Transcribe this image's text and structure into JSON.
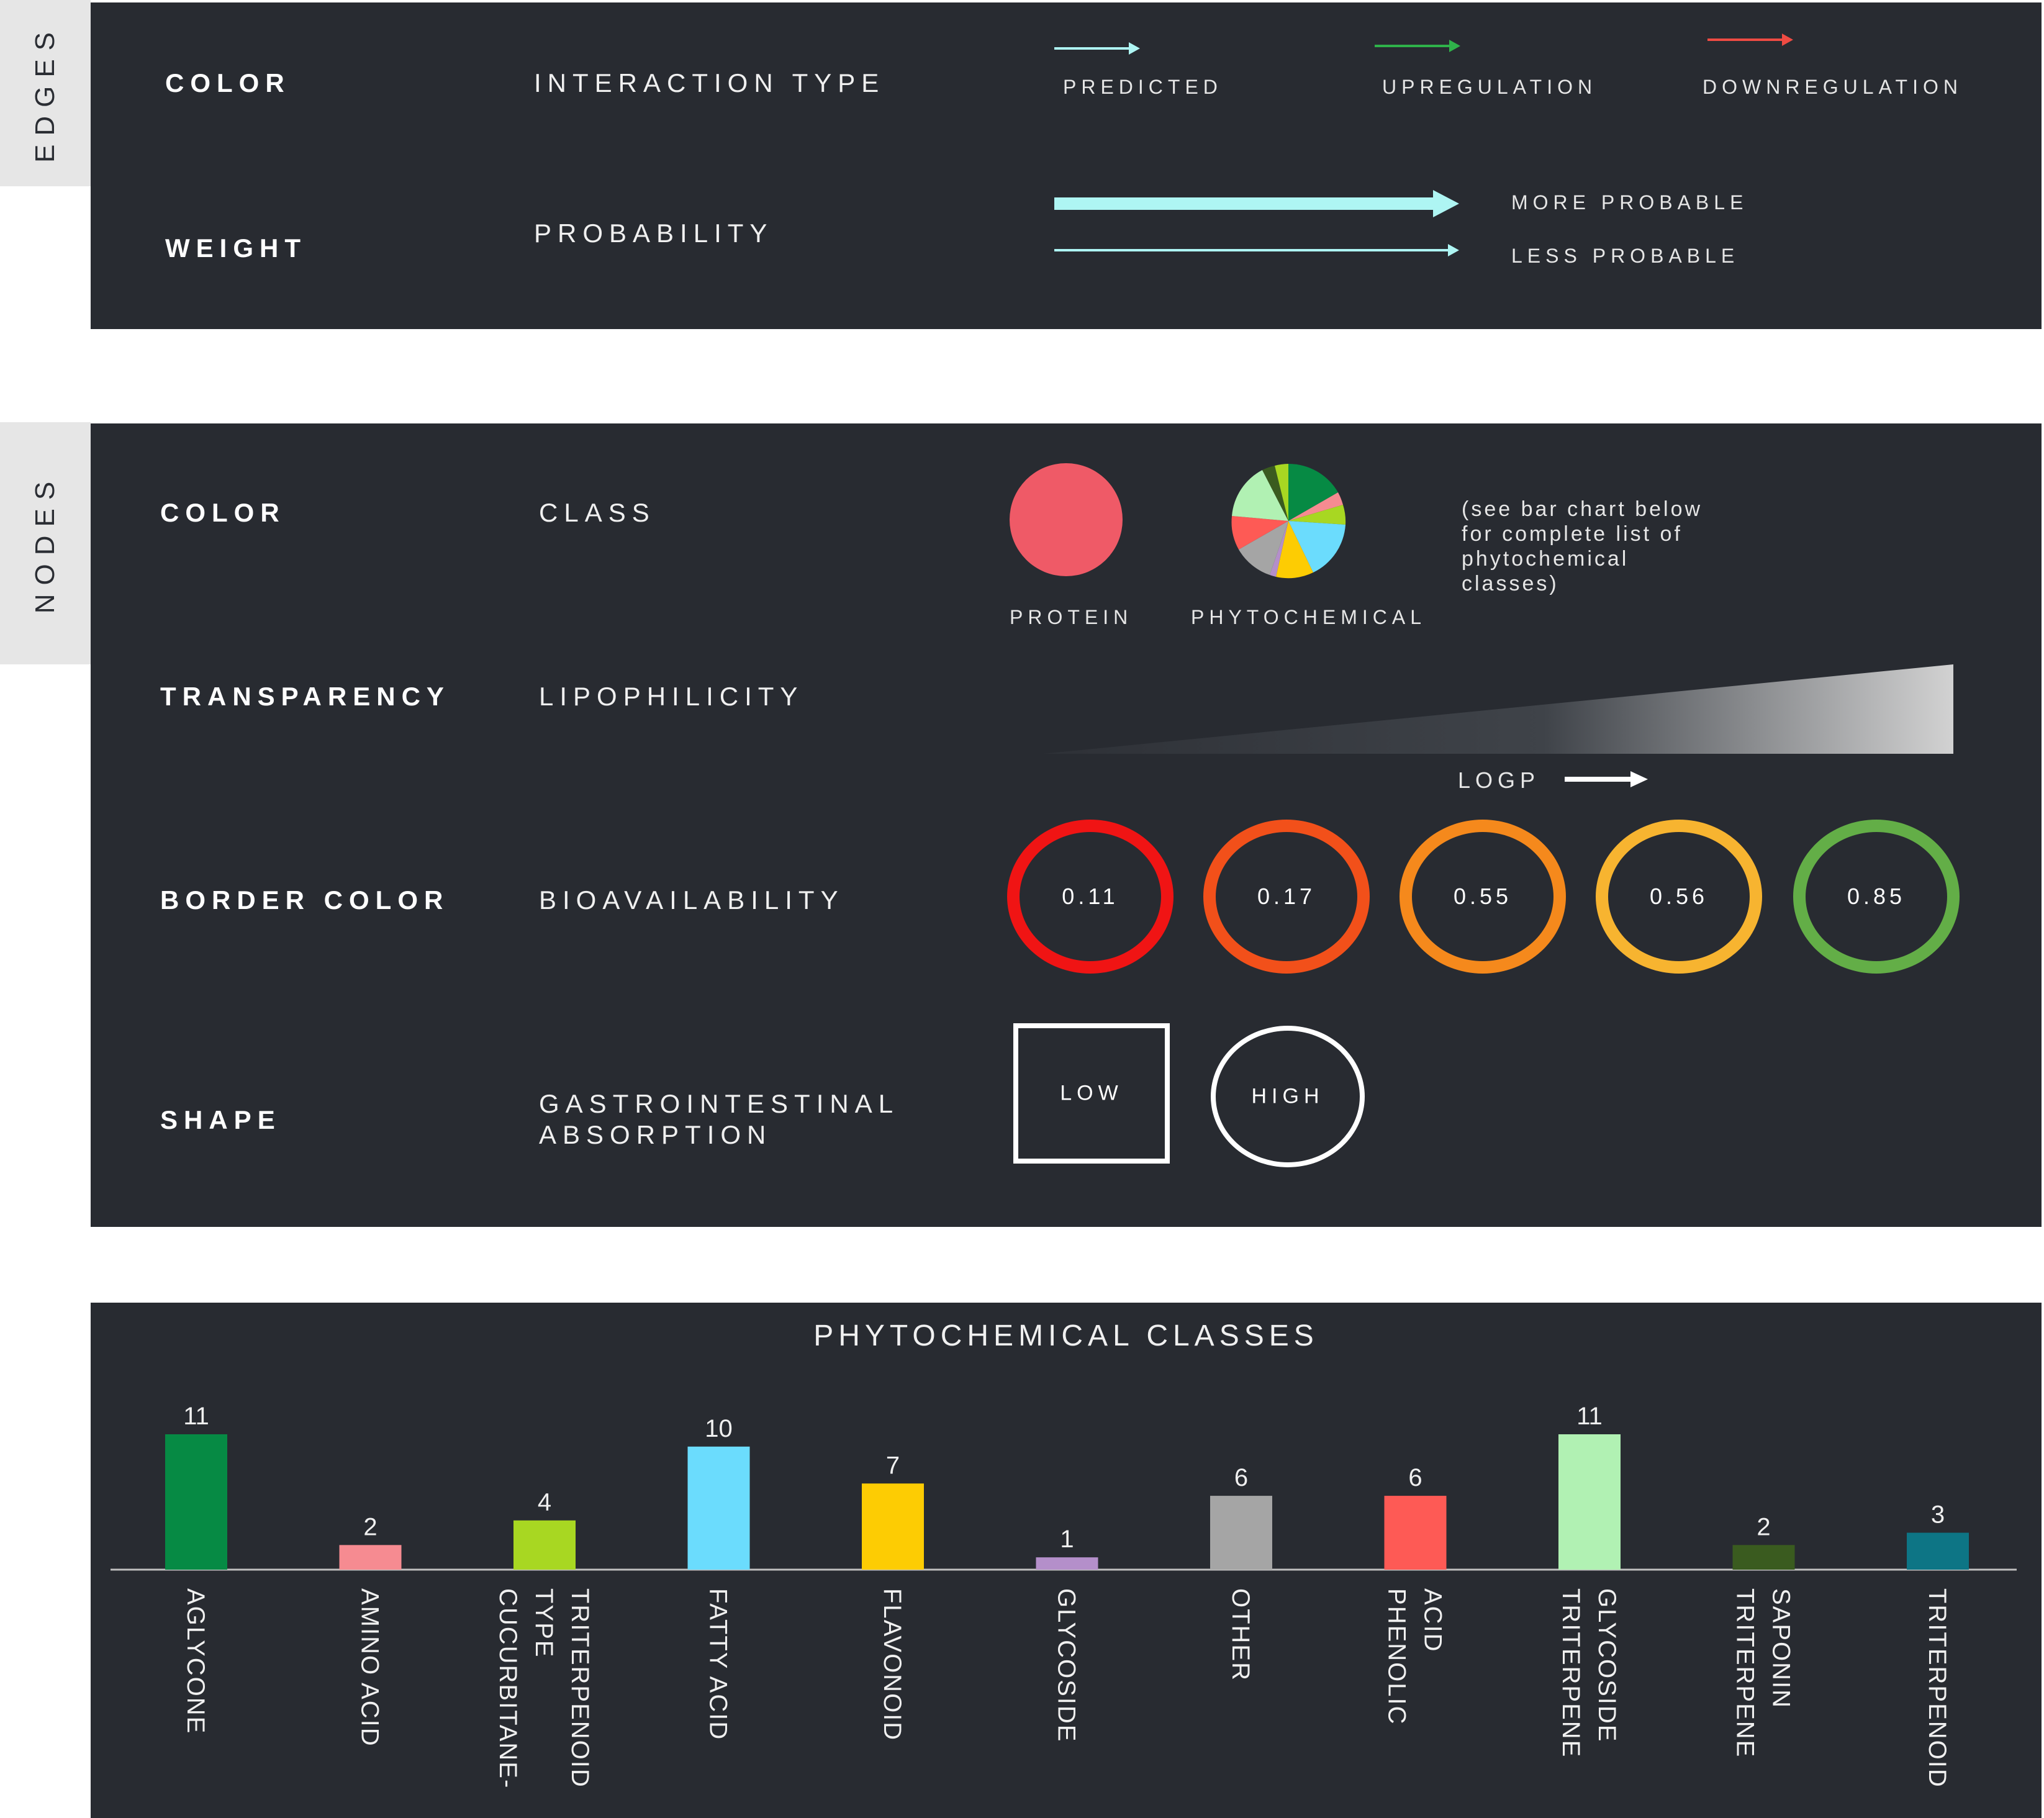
{
  "edges": {
    "section_label": "EDGES",
    "color_row": {
      "heading": "COLOR",
      "attribute": "INTERACTION TYPE",
      "legend": [
        {
          "label": "PREDICTED",
          "color": "#aef5f3"
        },
        {
          "label": "UPREGULATION",
          "color": "#2fb24a"
        },
        {
          "label": "DOWNREGULATION",
          "color": "#ef4b43"
        }
      ]
    },
    "weight_row": {
      "heading": "WEIGHT",
      "attribute": "PROBABILITY",
      "more_label": "MORE PROBABLE",
      "less_label": "LESS PROBABLE",
      "arrow_color": "#aef5f3"
    }
  },
  "nodes": {
    "section_label": "NODES",
    "color_row": {
      "heading": "COLOR",
      "attribute": "CLASS",
      "protein_label": "PROTEIN",
      "protein_color": "#ef5a67",
      "phytochemical_label": "PHYTOCHEMICAL",
      "note": "(see bar chart below\nfor complete list of\nphytochemical\nclasses)"
    },
    "transparency_row": {
      "heading": "TRANSPARENCY",
      "attribute": "LIPOPHILICITY",
      "axis_label": "LOGP"
    },
    "border_row": {
      "heading": "BORDER COLOR",
      "attribute": "BIOAVAILABILITY",
      "values": [
        {
          "label": "0.11",
          "color": "#f01414"
        },
        {
          "label": "0.17",
          "color": "#f2501a"
        },
        {
          "label": "0.55",
          "color": "#f5891c"
        },
        {
          "label": "0.56",
          "color": "#f7b430"
        },
        {
          "label": "0.85",
          "color": "#63ae47"
        }
      ]
    },
    "shape_row": {
      "heading": "SHAPE",
      "attribute_line1": "GASTROINTESTINAL",
      "attribute_line2": "ABSORPTION",
      "low_label": "LOW",
      "high_label": "HIGH"
    }
  },
  "chart_data": {
    "type": "bar",
    "title": "PHYTOCHEMICAL CLASSES",
    "categories": [
      [
        "AGLYCONE"
      ],
      [
        "AMINO ACID"
      ],
      [
        "CUCURBITANE-",
        "TYPE",
        "TRITERPENOID"
      ],
      [
        "FATTY ACID"
      ],
      [
        "FLAVONOID"
      ],
      [
        "GLYCOSIDE"
      ],
      [
        "OTHER"
      ],
      [
        "PHENOLIC",
        "ACID"
      ],
      [
        "TRITERPENE",
        "GLYCOSIDE"
      ],
      [
        "TRITERPENE",
        "SAPONIN"
      ],
      [
        "TRITERPENOID"
      ]
    ],
    "values": [
      11,
      2,
      4,
      10,
      7,
      1,
      6,
      6,
      11,
      2,
      3
    ],
    "colors": [
      "#068a44",
      "#f68b91",
      "#a8d722",
      "#6bdcfd",
      "#fdcc03",
      "#b48fca",
      "#a5a5a5",
      "#fe5a55",
      "#b1f1b3",
      "#3a5b1f",
      "#0d7585"
    ],
    "ylim": [
      0,
      11
    ]
  }
}
